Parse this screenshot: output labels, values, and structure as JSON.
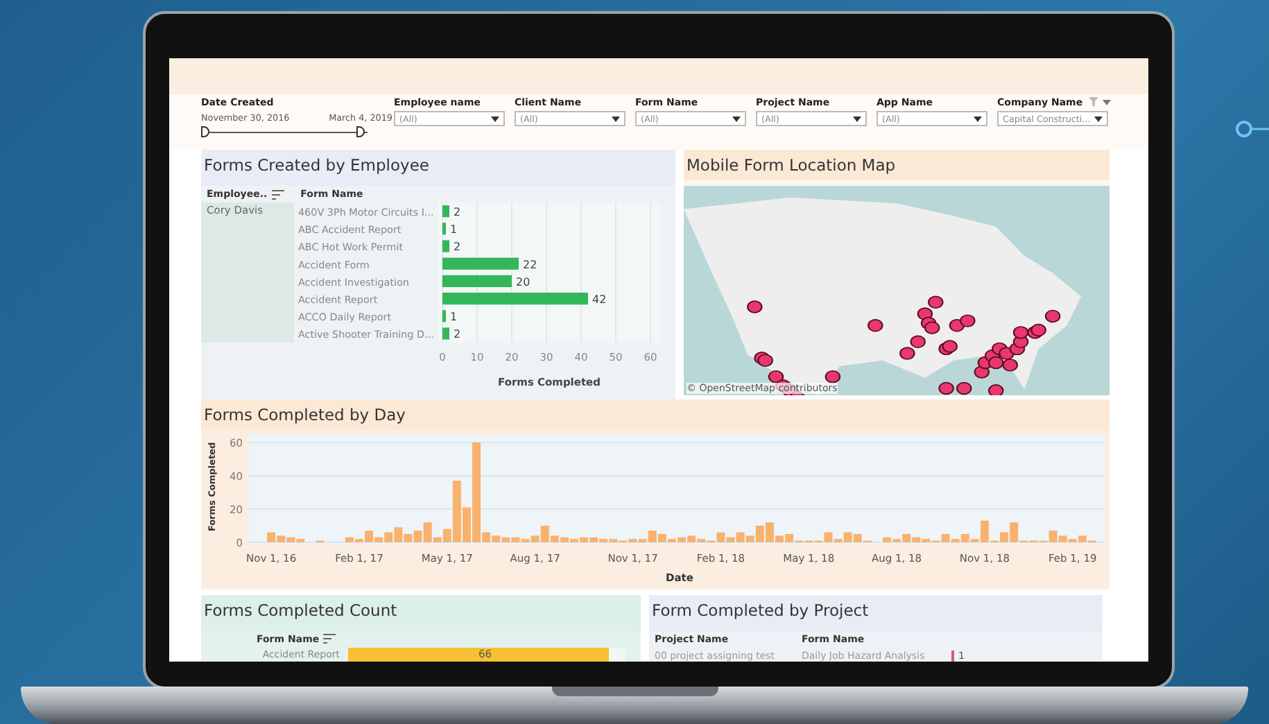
{
  "filters": {
    "date": {
      "label": "Date Created",
      "start": "November 30, 2016",
      "end": "March 4, 2019",
      "thumbs": [
        {
          "level": 0
        },
        {
          "level": 1
        }
      ]
    },
    "dropdowns": [
      {
        "label": "Employee name",
        "value": "(All)"
      },
      {
        "label": "Client Name",
        "value": "(All)"
      },
      {
        "label": "Form Name",
        "value": "(All)"
      },
      {
        "label": "Project Name",
        "value": "(All)"
      },
      {
        "label": "App Name",
        "value": "(All)"
      },
      {
        "label": "Company Name",
        "value": "Capital Constructi...",
        "filter_icon": true
      }
    ]
  },
  "employee_panel": {
    "title": "Forms Created by Employee",
    "columns": [
      "Employee..",
      "Form Name"
    ],
    "employee": "Cory Davis",
    "chart_data": {
      "type": "bar",
      "orientation": "horizontal",
      "xlabel": "Forms Completed",
      "categories": [
        "460V 3Ph Motor Circuits I...",
        "ABC Accident Report",
        "ABC Hot Work Permit",
        "Accident Form",
        "Accident Investigation",
        "Accident Report",
        "ACCO Daily Report",
        "Active Shooter Training D..."
      ],
      "series": [
        {
          "color": "#34b65a",
          "values": [
            2,
            1,
            2,
            22,
            20,
            42,
            1,
            2
          ]
        }
      ],
      "xlim": [
        0,
        60
      ],
      "xticks": [
        0,
        10,
        20,
        30,
        40,
        50,
        60
      ],
      "grid": true,
      "data_labels": true
    }
  },
  "map_panel": {
    "title": "Mobile Form Location Map",
    "attribution": "© OpenStreetMap contributors"
  },
  "day_panel": {
    "title": "Forms Completed by Day",
    "chart_data": {
      "type": "bar",
      "xlabel": "Date",
      "ylabel": "Forms Completed",
      "ylim": [
        0,
        60
      ],
      "yticks": [
        0,
        20,
        40,
        60
      ],
      "categories": [
        null,
        "Nov 1, 16",
        null,
        null,
        null,
        null,
        null,
        null,
        null,
        null,
        "Feb 1, 17",
        null,
        null,
        null,
        null,
        null,
        null,
        null,
        null,
        "May 1, 17",
        null,
        null,
        null,
        null,
        null,
        null,
        null,
        null,
        "Aug 1, 17",
        null,
        null,
        null,
        null,
        null,
        null,
        null,
        null,
        null,
        "Nov 1, 17",
        null,
        null,
        null,
        null,
        null,
        null,
        null,
        null,
        "Feb 1, 18",
        null,
        null,
        null,
        null,
        null,
        null,
        null,
        null,
        "May 1, 18",
        null,
        null,
        null,
        null,
        null,
        null,
        null,
        null,
        "Aug 1, 18",
        null,
        null,
        null,
        null,
        null,
        null,
        null,
        null,
        "Nov 1, 18",
        null,
        null,
        null,
        null,
        null,
        null,
        null,
        null,
        "Feb 1, 19",
        null,
        null
      ],
      "series": [
        {
          "color": "#f9b26e",
          "values": [
            0,
            6,
            4,
            3,
            2,
            0,
            1,
            0,
            0,
            3,
            2,
            7,
            3,
            6,
            9,
            5,
            7,
            12,
            3,
            8,
            37,
            21,
            60,
            6,
            4,
            3,
            3,
            2,
            4,
            10,
            4,
            3,
            2,
            3,
            3,
            2,
            2,
            1,
            2,
            2,
            7,
            5,
            2,
            3,
            4,
            2,
            1,
            6,
            3,
            6,
            4,
            10,
            12,
            4,
            5,
            1,
            1,
            1,
            6,
            2,
            6,
            5,
            1,
            0,
            3,
            2,
            5,
            3,
            2,
            1,
            5,
            2,
            5,
            2,
            13,
            1,
            6,
            12,
            1,
            1,
            1,
            7,
            4,
            2,
            4,
            1
          ]
        }
      ]
    }
  },
  "count_panel": {
    "title": "Forms Completed Count",
    "column": "Form Name",
    "rows": [
      {
        "label": "Accident Report",
        "value": "66",
        "level": 0.94
      }
    ]
  },
  "project_panel": {
    "title": "Form Completed by Project",
    "columns": [
      "Project Name",
      "Form Name"
    ],
    "rows": [
      {
        "project": "00 project assigning test",
        "form": "Daily Job Hazard Analysis",
        "count": "1"
      }
    ]
  }
}
